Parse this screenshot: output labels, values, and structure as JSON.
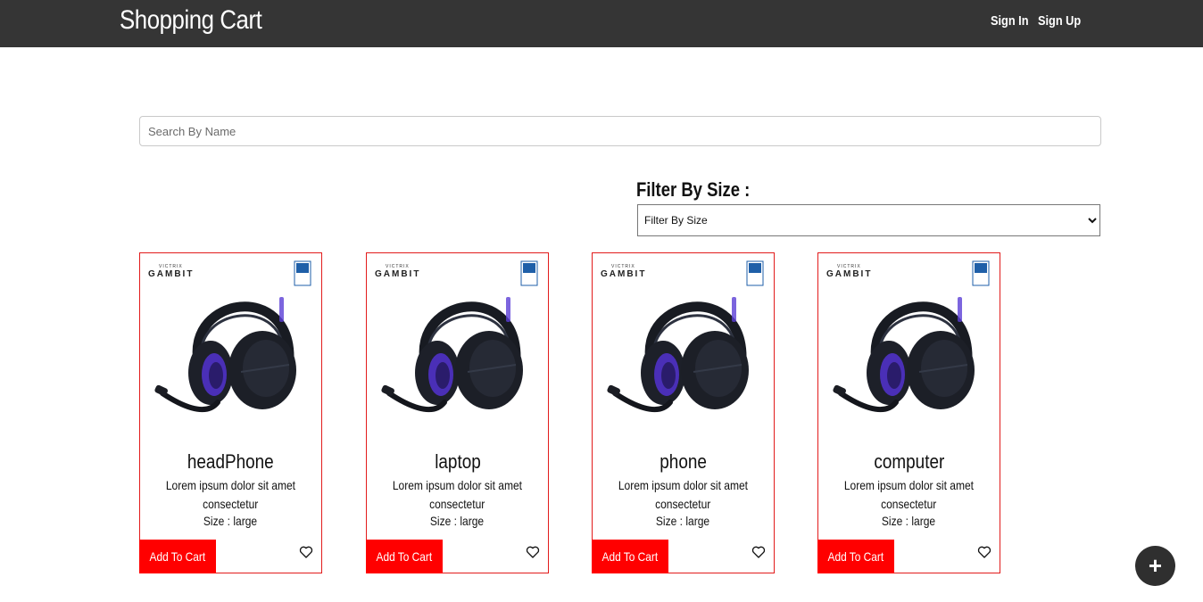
{
  "header": {
    "brand": "Shopping Cart",
    "sign_in": "Sign In",
    "sign_up": "Sign Up"
  },
  "search": {
    "placeholder": "Search By Name",
    "value": ""
  },
  "filter": {
    "heading": "Filter By Size :",
    "selected": "Filter By Size"
  },
  "product_image": {
    "brand_top": "VICTRIX",
    "brand_main": "GAMBIT",
    "badge": "Official Licensed Product"
  },
  "products": [
    {
      "title": "headPhone",
      "desc_line1": "Lorem ipsum dolor sit amet",
      "desc_line2": "consectetur",
      "size": "Size : large",
      "add_label": "Add To Cart"
    },
    {
      "title": "laptop",
      "desc_line1": "Lorem ipsum dolor sit amet",
      "desc_line2": "consectetur",
      "size": "Size : large",
      "add_label": "Add To Cart"
    },
    {
      "title": "phone",
      "desc_line1": "Lorem ipsum dolor sit amet",
      "desc_line2": "consectetur",
      "size": "Size : large",
      "add_label": "Add To Cart"
    },
    {
      "title": "computer",
      "desc_line1": "Lorem ipsum dolor sit amet",
      "desc_line2": "consectetur",
      "size": "Size : large",
      "add_label": "Add To Cart"
    }
  ],
  "icons": {
    "favorite": "heart-icon",
    "add": "plus-icon"
  },
  "fab_label": "+",
  "colors": {
    "header_bg": "#353535",
    "accent": "#ff0000",
    "card_border": "#e21b1b",
    "fab_bg": "#2f2f2f"
  }
}
